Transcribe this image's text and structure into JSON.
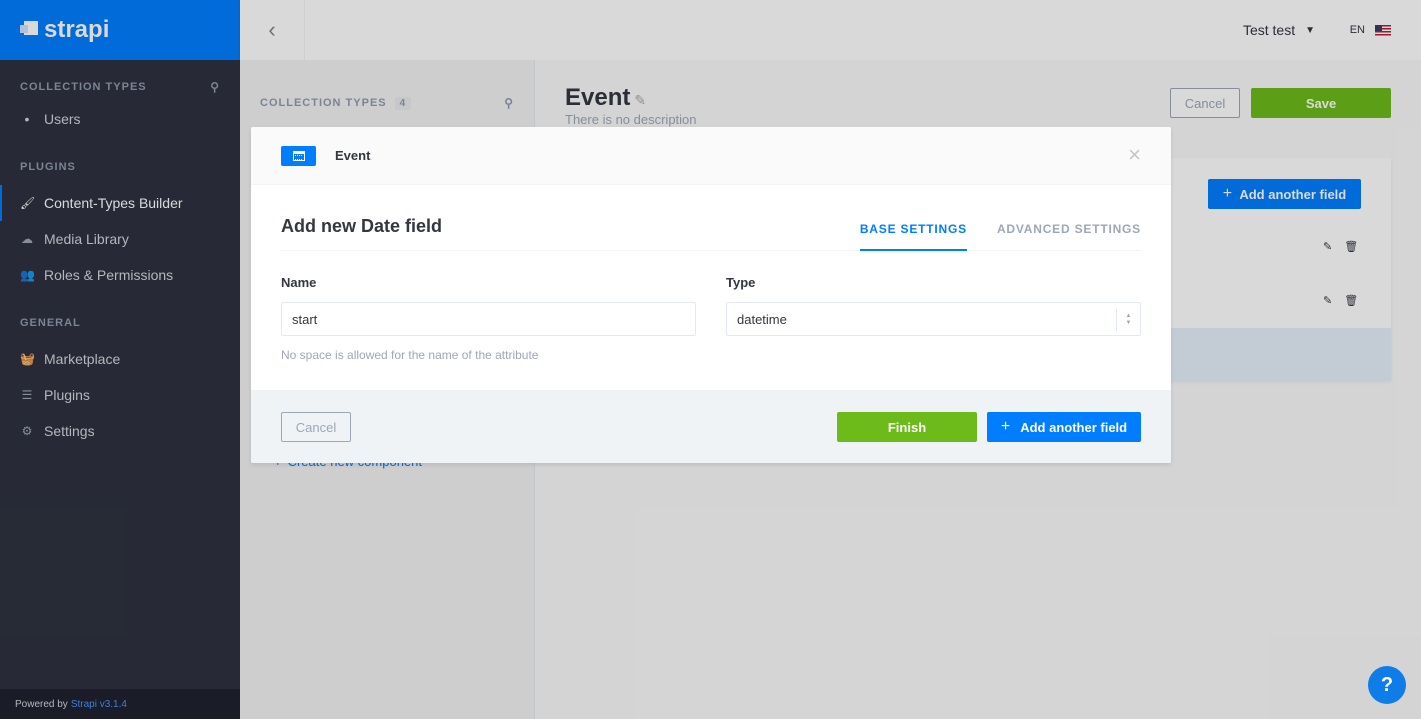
{
  "brand": {
    "name": "strapi"
  },
  "sidebar": {
    "sections": [
      {
        "title": "COLLECTION TYPES",
        "items": [
          {
            "label": "Users",
            "icon": "dot"
          }
        ]
      },
      {
        "title": "PLUGINS",
        "items": [
          {
            "label": "Content-Types Builder",
            "icon": "paint-brush-icon",
            "active": true
          },
          {
            "label": "Media Library",
            "icon": "cloud-icon"
          },
          {
            "label": "Roles & Permissions",
            "icon": "users-icon"
          }
        ]
      },
      {
        "title": "GENERAL",
        "items": [
          {
            "label": "Marketplace",
            "icon": "shopping-basket-icon"
          },
          {
            "label": "Plugins",
            "icon": "list-icon"
          },
          {
            "label": "Settings",
            "icon": "gear-icon"
          }
        ]
      }
    ],
    "footer": {
      "prefix": "Powered by",
      "version": "Strapi v3.1.4"
    }
  },
  "header": {
    "user": "Test test",
    "lang": "EN"
  },
  "ctlist": {
    "title": "COLLECTION TYPES",
    "count": "4",
    "create_component": "Create new component"
  },
  "main": {
    "title": "Event",
    "description": "There is no description",
    "cancel": "Cancel",
    "save": "Save",
    "add_field": "Add another field"
  },
  "modal": {
    "content_type": "Event",
    "title": "Add new Date field",
    "tabs": [
      {
        "label": "BASE SETTINGS",
        "active": true
      },
      {
        "label": "ADVANCED SETTINGS",
        "active": false
      }
    ],
    "name_label": "Name",
    "name_value": "start",
    "name_hint": "No space is allowed for the name of the attribute",
    "type_label": "Type",
    "type_value": "datetime",
    "cancel": "Cancel",
    "finish": "Finish",
    "add_field": "Add another field"
  },
  "help": {
    "label": "?"
  },
  "colors": {
    "primary": "#007eff",
    "success": "#6dbb1a",
    "sidebar": "#2e3240"
  }
}
